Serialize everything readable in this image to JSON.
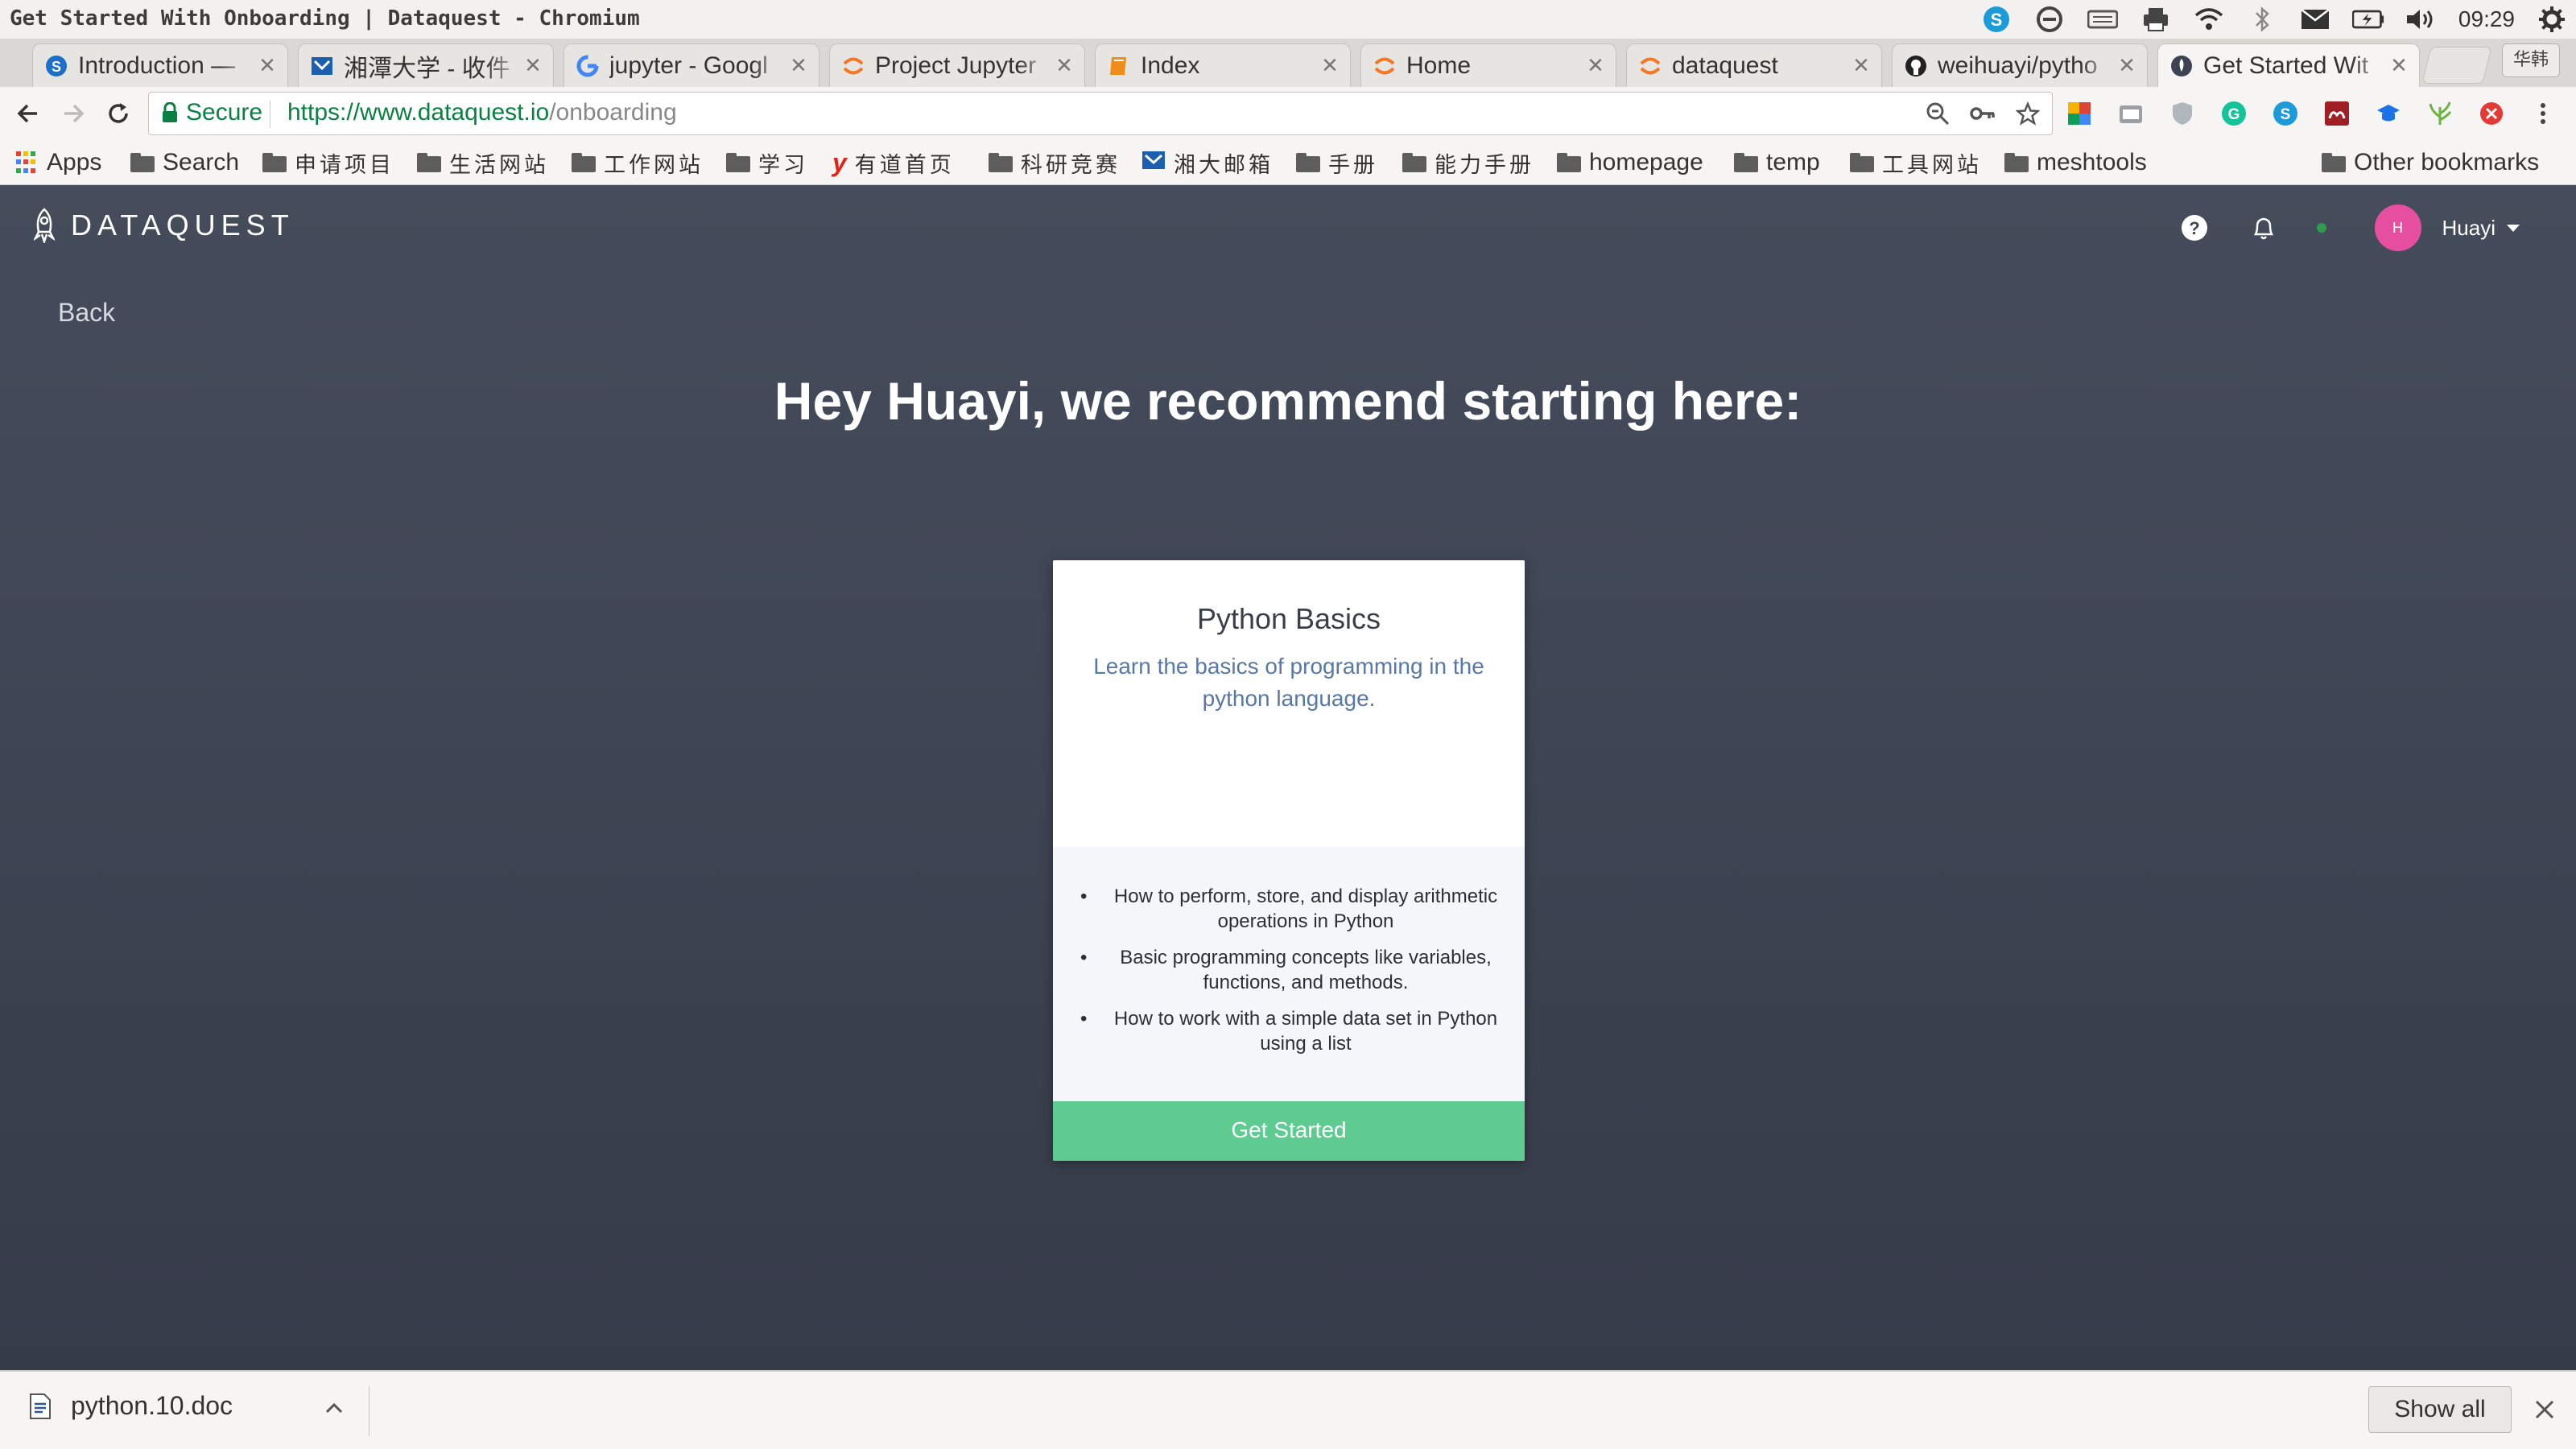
{
  "window": {
    "title": "Get Started With Onboarding | Dataquest - Chromium",
    "clock": "09:29",
    "profile_badge": "华韩"
  },
  "tabs": [
    {
      "label": "Introduction —",
      "icon": "skype-icon",
      "active": false
    },
    {
      "label": "湘潭大学 - 收件",
      "icon": "xtu-mail-icon",
      "active": false
    },
    {
      "label": "jupyter - Googl",
      "icon": "google-icon",
      "active": false
    },
    {
      "label": "Project Jupyter",
      "icon": "jupyter-icon",
      "active": false
    },
    {
      "label": "Index",
      "icon": "book-icon",
      "active": false
    },
    {
      "label": "Home",
      "icon": "jupyter-icon",
      "active": false
    },
    {
      "label": "dataquest",
      "icon": "jupyter-icon",
      "active": false
    },
    {
      "label": "weihuayi/pytho",
      "icon": "github-icon",
      "active": false
    },
    {
      "label": "Get Started Wit",
      "icon": "dataquest-icon",
      "active": true
    }
  ],
  "address": {
    "secure_label": "Secure",
    "url_scheme": "https://",
    "url_host": "www.dataquest.io",
    "url_path": "/onboarding"
  },
  "bookmarks": [
    {
      "label": "Apps",
      "type": "apps"
    },
    {
      "label": "Search",
      "type": "folder"
    },
    {
      "label": "申请项目",
      "type": "folder"
    },
    {
      "label": "生活网站",
      "type": "folder"
    },
    {
      "label": "工作网站",
      "type": "folder"
    },
    {
      "label": "学习",
      "type": "folder"
    },
    {
      "label": "有道首页",
      "type": "youdao"
    },
    {
      "label": "科研竞赛",
      "type": "folder"
    },
    {
      "label": "湘大邮箱",
      "type": "xtu"
    },
    {
      "label": "手册",
      "type": "folder"
    },
    {
      "label": "能力手册",
      "type": "folder"
    },
    {
      "label": "homepage",
      "type": "folder"
    },
    {
      "label": "temp",
      "type": "folder"
    },
    {
      "label": "工具网站",
      "type": "folder"
    },
    {
      "label": "meshtools",
      "type": "folder"
    },
    {
      "label": "Other bookmarks",
      "type": "folder"
    }
  ],
  "site": {
    "logo_text": "DATAQUEST",
    "user_initial": "H",
    "user_name": "Huayi",
    "back_label": "Back",
    "heading": "Hey Huayi, we recommend starting here:"
  },
  "card": {
    "title": "Python Basics",
    "description": "Learn the basics of programming in the python language.",
    "points": [
      "How to perform, store, and display arithmetic operations in Python",
      "Basic programming concepts like variables, functions, and methods.",
      "How to work with a simple data set in Python using a list"
    ],
    "button_label": "Get Started"
  },
  "downloads": {
    "file_name": "python.10.doc",
    "show_all_label": "Show all"
  },
  "colors": {
    "page_background": "#3f4554",
    "card_description": "#5878a6",
    "get_started_button": "#5ecb91",
    "avatar": "#e64ea0",
    "secure_green": "#0b8043"
  }
}
